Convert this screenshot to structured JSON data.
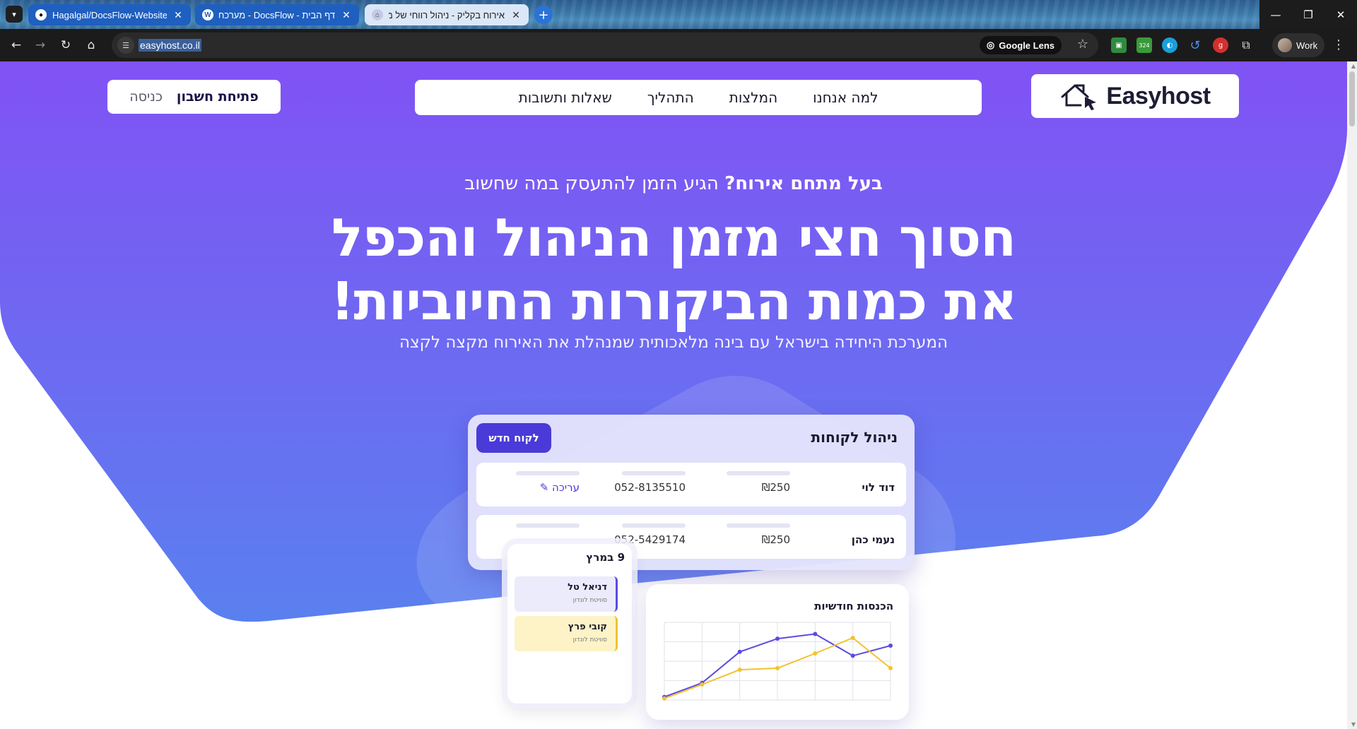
{
  "browser": {
    "tabs": [
      {
        "label": "Hagalgal/DocsFlow-Website",
        "icon": "github-icon",
        "active": false
      },
      {
        "label": "דף הבית - DocsFlow - מערכת ניה",
        "icon": "wordpress-icon",
        "active": false
      },
      {
        "label": "אירוח בקליק - ניהול רווחי של מו",
        "icon": "easyhost-icon",
        "active": true
      }
    ],
    "url": "easyhost.co.il",
    "lens_label": "Google Lens",
    "profile_label": "Work",
    "extension_badge": "324"
  },
  "site": {
    "logo_text": "Easyhost",
    "nav": [
      "למה אנחנו",
      "המלצות",
      "התהליך",
      "שאלות ותשובות"
    ],
    "auth": {
      "signup": "פתיחת חשבון",
      "login": "כניסה"
    },
    "tagline_bold": "בעל מתחם אירוח?",
    "tagline_rest": " הגיע הזמן להתעסק במה שחשוב",
    "headline_1": "חסוך חצי מזמן הניהול והכפל",
    "headline_2": "את כמות הביקורות החיוביות!",
    "subline": "המערכת היחידה בישראל עם בינה מלאכותית שמנהלת את האירוח מקצה לקצה",
    "colors": {
      "hero_top": "#8152f4",
      "hero_bottom": "#5a80ef",
      "accent": "#4a3ad8"
    }
  },
  "clients_card": {
    "title": "ניהול לקוחות",
    "new_button": "לקוח חדש",
    "edit_label": "עריכה",
    "rows": [
      {
        "name": "דוד לוי",
        "price": "₪250",
        "phone": "052-8135510"
      },
      {
        "name": "נעמי כהן",
        "price": "₪250",
        "phone": "052-5429174"
      }
    ]
  },
  "calendar_card": {
    "date": "9 במרץ",
    "events": [
      {
        "name": "דניאל טל",
        "subtitle": "סוויטת לונדון"
      },
      {
        "name": "קובי פרץ",
        "subtitle": "סוויטת לונדון"
      }
    ]
  },
  "chart_card": {
    "title": "הכנסות חודשיות"
  },
  "chart_data": {
    "type": "line",
    "x": [
      1,
      2,
      3,
      4,
      5,
      6,
      7
    ],
    "series": [
      {
        "color": "#5b4be0",
        "values": [
          4,
          22,
          62,
          79,
          85,
          57,
          70
        ]
      },
      {
        "color": "#f2c230",
        "values": [
          2,
          20,
          39,
          41,
          60,
          80,
          41
        ]
      }
    ],
    "ylim": [
      0,
      100
    ],
    "grid": true
  }
}
